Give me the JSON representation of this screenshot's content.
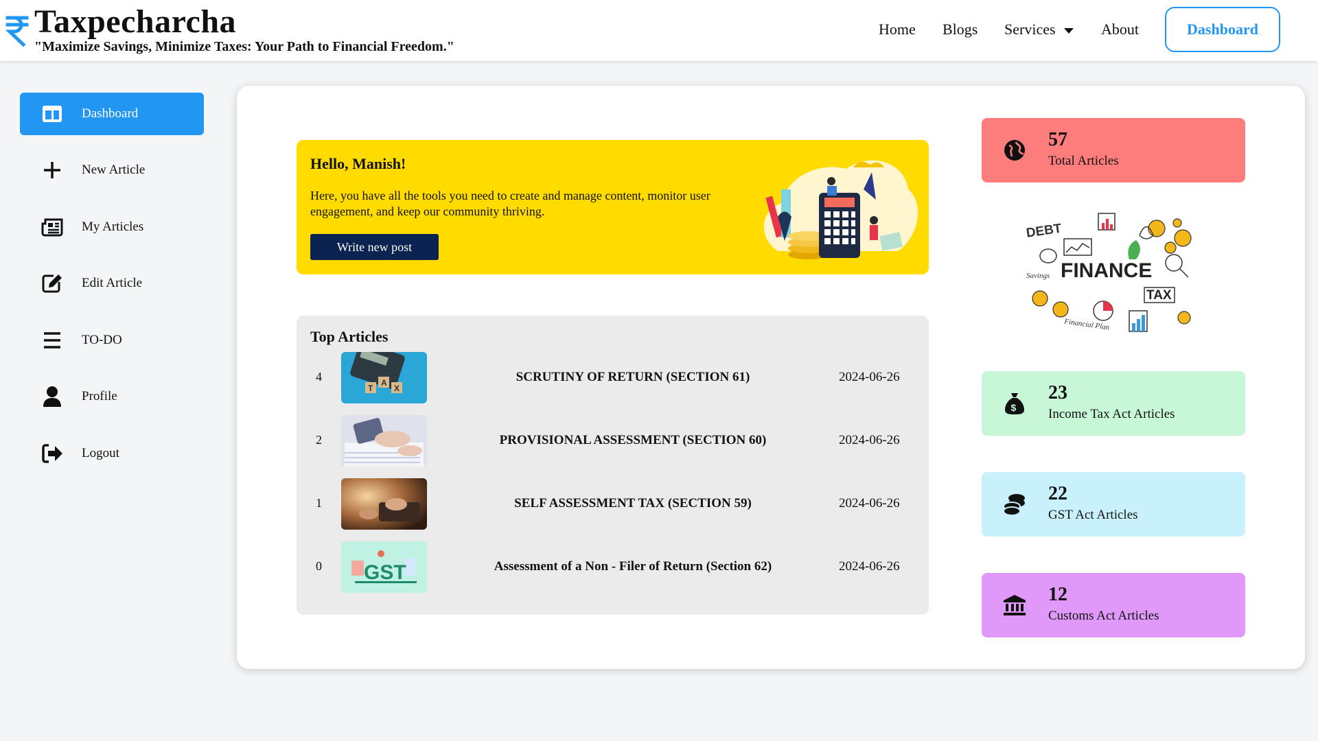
{
  "header": {
    "brand": "Taxpecharcha",
    "logo_icon": "rupee-icon",
    "tagline": "\"Maximize Savings, Minimize Taxes: Your Path to Financial Freedom.\"",
    "nav": {
      "home": "Home",
      "blogs": "Blogs",
      "services": "Services",
      "about": "About"
    },
    "dashboard_button": "Dashboard",
    "accent_color": "#2196f3"
  },
  "sidebar": {
    "items": [
      {
        "label": "Dashboard",
        "icon": "dashboard-icon",
        "active": true
      },
      {
        "label": "New Article",
        "icon": "plus-icon"
      },
      {
        "label": "My Articles",
        "icon": "newspaper-icon"
      },
      {
        "label": "Edit Article",
        "icon": "edit-icon"
      },
      {
        "label": "TO-DO",
        "icon": "list-icon"
      },
      {
        "label": "Profile",
        "icon": "user-icon"
      },
      {
        "label": "Logout",
        "icon": "logout-icon"
      }
    ]
  },
  "welcome": {
    "greeting": "Hello, Manish!",
    "message": "Here, you have all the tools you need to create and manage content, monitor user engagement, and keep our community thriving.",
    "button": "Write new post",
    "bg_color": "#ffdb00"
  },
  "top_articles": {
    "heading": "Top Articles",
    "rows": [
      {
        "views": "4",
        "title": "SCRUTINY OF RETURN (SECTION 61)",
        "date": "2024-06-26"
      },
      {
        "views": "2",
        "title": "PROVISIONAL ASSESSMENT (SECTION 60)",
        "date": "2024-06-26"
      },
      {
        "views": "1",
        "title": "SELF ASSESSMENT TAX (SECTION 59)",
        "date": "2024-06-26"
      },
      {
        "views": "0",
        "title": "Assessment of a Non - Filer of Return (Section 62)",
        "date": "2024-06-26"
      }
    ]
  },
  "stats": [
    {
      "count": "57",
      "label": "Total Articles",
      "icon": "globe-icon",
      "color": "#fd7d7d"
    },
    {
      "count": "23",
      "label": "Income Tax Act Articles",
      "icon": "money-bag-icon",
      "color": "#c8f7d8"
    },
    {
      "count": "22",
      "label": "GST Act Articles",
      "icon": "coins-icon",
      "color": "#c9f1fb"
    },
    {
      "count": "12",
      "label": "Customs Act Articles",
      "icon": "bank-icon",
      "color": "#e099f9"
    }
  ],
  "finance_illustration": {
    "big_word": "FINANCE",
    "words": [
      "DEBT",
      "TAX",
      "Savings",
      "Financial Plan"
    ]
  }
}
